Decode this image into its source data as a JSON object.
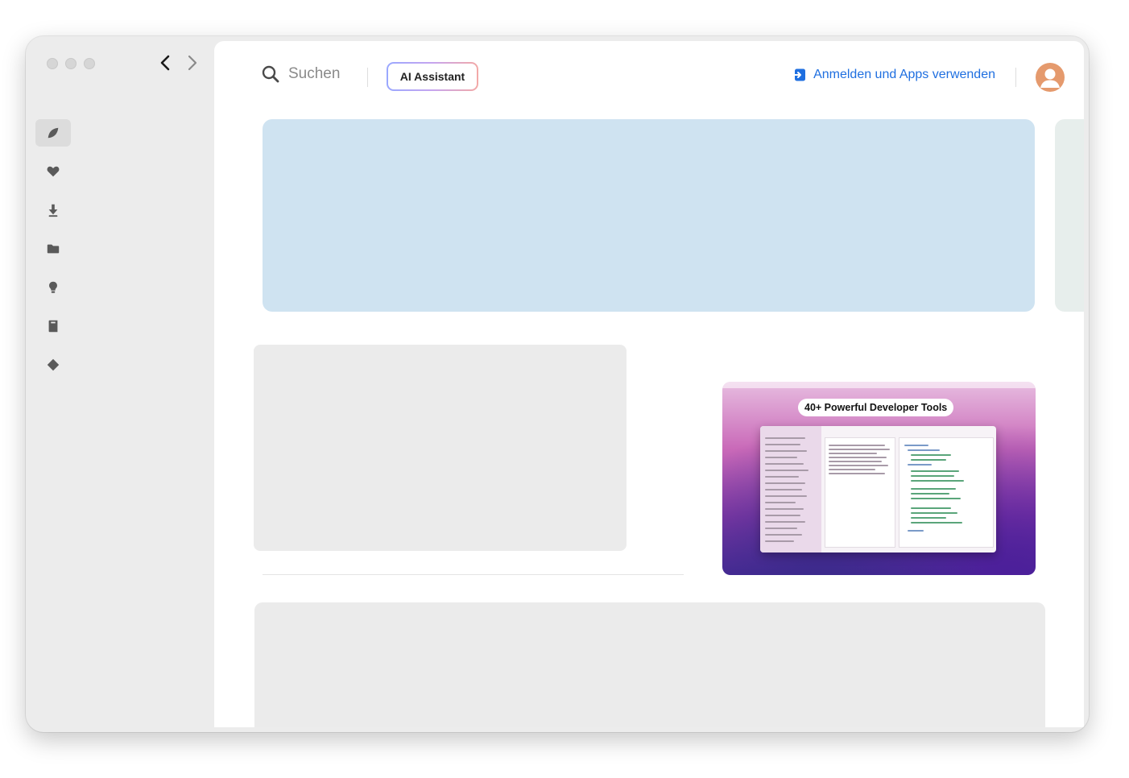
{
  "sidebar": {
    "items": [
      {
        "icon": "leaf-icon",
        "active": true
      },
      {
        "icon": "heart-icon",
        "active": false
      },
      {
        "icon": "download-icon",
        "active": false
      },
      {
        "icon": "folder-icon",
        "active": false
      },
      {
        "icon": "lightbulb-icon",
        "active": false
      },
      {
        "icon": "book-icon",
        "active": false
      },
      {
        "icon": "diamond-icon",
        "active": false
      }
    ]
  },
  "header": {
    "search_label": "Suchen",
    "ai_button_label": "AI Assistant",
    "signin_label": "Anmelden und Apps verwenden"
  },
  "promo": {
    "headline": "40+ Powerful Developer Tools"
  },
  "colors": {
    "accent": "#1f6fe0",
    "hero_bg": "#cfe3f1",
    "placeholder_bg": "#ebebeb"
  }
}
